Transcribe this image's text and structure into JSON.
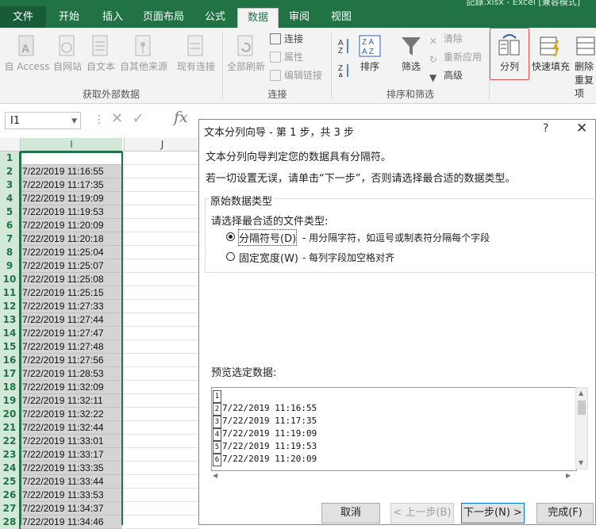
{
  "window": {
    "title_fragment": "記錄.xlsx - Excel [兼容模式]"
  },
  "ribbon_tabs": [
    "文件",
    "开始",
    "插入",
    "页面布局",
    "公式",
    "数据",
    "审阅",
    "视图"
  ],
  "ribbon": {
    "get_external": {
      "label": "获取外部数据",
      "buttons": [
        "自 Access",
        "自网站",
        "自文本",
        "自其他来源",
        "现有连接"
      ]
    },
    "connections": {
      "label": "连接",
      "refresh_all": "全部刷新",
      "items": [
        "连接",
        "属性",
        "编辑链接"
      ]
    },
    "sort_filter": {
      "label": "排序和筛选",
      "sort": "排序",
      "filter": "筛选",
      "items": [
        "清除",
        "重新应用",
        "高级"
      ]
    },
    "tools": {
      "split": "分列",
      "flash_fill": "快速填充",
      "remove_dup_line1": "删除",
      "remove_dup_line2": "重复项"
    }
  },
  "formula_bar": {
    "name_box": "I1",
    "fx": "fx"
  },
  "sheet": {
    "columns": [
      "I",
      "J"
    ],
    "rows": [
      {
        "n": "1",
        "v": ""
      },
      {
        "n": "2",
        "v": "7/22/2019 11:16:55"
      },
      {
        "n": "3",
        "v": "7/22/2019 11:17:35"
      },
      {
        "n": "4",
        "v": "7/22/2019 11:19:09"
      },
      {
        "n": "5",
        "v": "7/22/2019 11:19:53"
      },
      {
        "n": "6",
        "v": "7/22/2019 11:20:09"
      },
      {
        "n": "7",
        "v": "7/22/2019 11:20:18"
      },
      {
        "n": "8",
        "v": "7/22/2019 11:25:04"
      },
      {
        "n": "9",
        "v": "7/22/2019 11:25:07"
      },
      {
        "n": "10",
        "v": "7/22/2019 11:25:08"
      },
      {
        "n": "11",
        "v": "7/22/2019 11:25:15"
      },
      {
        "n": "12",
        "v": "7/22/2019 11:27:33"
      },
      {
        "n": "13",
        "v": "7/22/2019 11:27:44"
      },
      {
        "n": "14",
        "v": "7/22/2019 11:27:47"
      },
      {
        "n": "15",
        "v": "7/22/2019 11:27:48"
      },
      {
        "n": "16",
        "v": "7/22/2019 11:27:56"
      },
      {
        "n": "17",
        "v": "7/22/2019 11:28:53"
      },
      {
        "n": "18",
        "v": "7/22/2019 11:32:09"
      },
      {
        "n": "19",
        "v": "7/22/2019 11:32:11"
      },
      {
        "n": "20",
        "v": "7/22/2019 11:32:22"
      },
      {
        "n": "21",
        "v": "7/22/2019 11:32:44"
      },
      {
        "n": "22",
        "v": "7/22/2019 11:33:01"
      },
      {
        "n": "23",
        "v": "7/22/2019 11:33:17"
      },
      {
        "n": "24",
        "v": "7/22/2019 11:33:35"
      },
      {
        "n": "25",
        "v": "7/22/2019 11:33:44"
      },
      {
        "n": "26",
        "v": "7/22/2019 11:33:53"
      },
      {
        "n": "27",
        "v": "7/22/2019 11:34:37"
      },
      {
        "n": "28",
        "v": "7/22/2019 11:34:46"
      }
    ]
  },
  "dialog": {
    "title": "文本分列向导 - 第 1 步，共 3 步",
    "help": "?",
    "close": "✕",
    "intro": "文本分列向导判定您的数据具有分隔符。",
    "instruction": "若一切设置无误，请单击“下一步”，否则请选择最合适的数据类型。",
    "group_title": "原始数据类型",
    "choose_label": "请选择最合适的文件类型:",
    "options": [
      {
        "label": "分隔符号(D)",
        "desc": "- 用分隔字符，如逗号或制表符分隔每个字段",
        "selected": true
      },
      {
        "label": "固定宽度(W)",
        "desc": "- 每列字段加空格对齐",
        "selected": false
      }
    ],
    "preview_label": "预览选定数据:",
    "preview_lines": [
      {
        "n": "1",
        "t": ""
      },
      {
        "n": "2",
        "t": "7/22/2019 11:16:55"
      },
      {
        "n": "3",
        "t": "7/22/2019 11:17:35"
      },
      {
        "n": "4",
        "t": "7/22/2019 11:19:09"
      },
      {
        "n": "5",
        "t": "7/22/2019 11:19:53"
      },
      {
        "n": "6",
        "t": "7/22/2019 11:20:09"
      }
    ],
    "buttons": {
      "cancel": "取消",
      "back": "< 上一步(B)",
      "next": "下一步(N) >",
      "finish": "完成(F)"
    }
  },
  "colors": {
    "excel_green": "#217346",
    "selection_fill": "#d4d4d4",
    "highlight_red": "#d9534f"
  }
}
